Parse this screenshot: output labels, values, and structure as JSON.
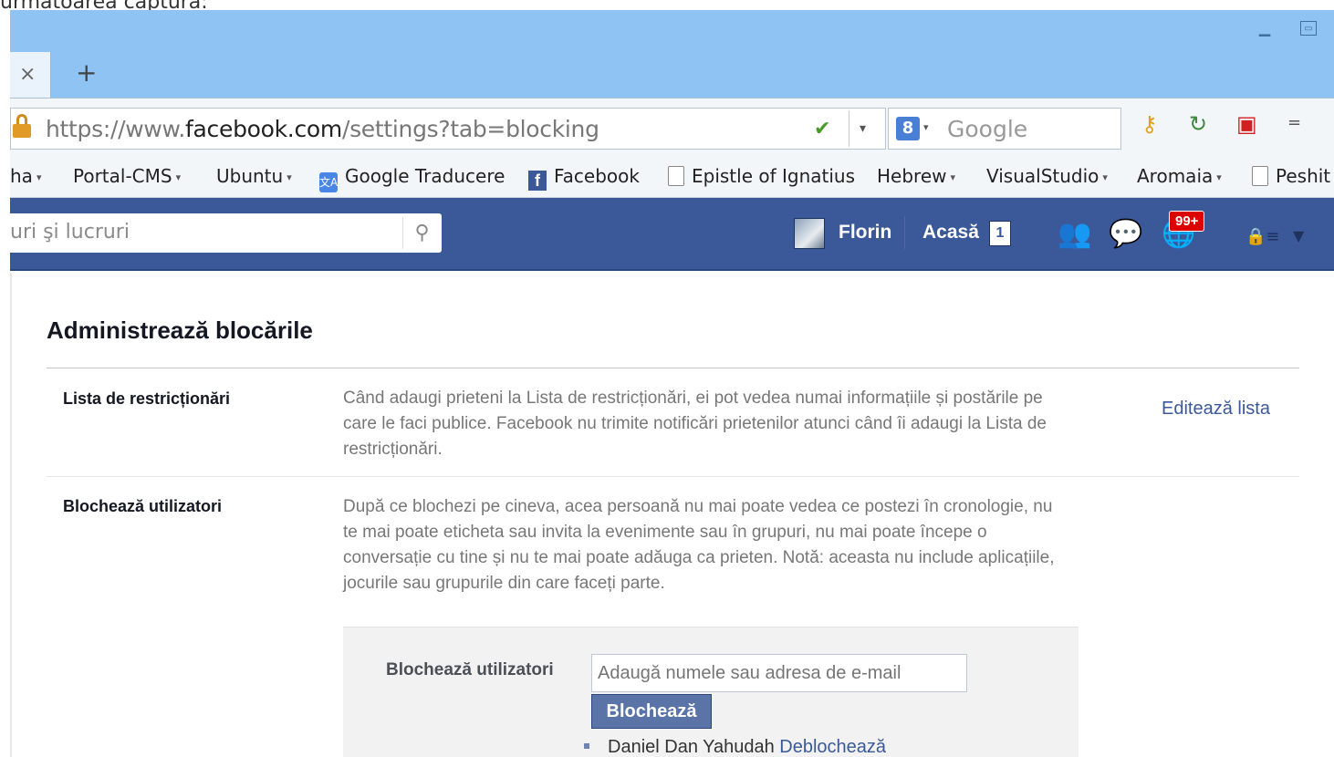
{
  "caption": "următoarea captură:",
  "window": {
    "minimize_icon": "minimize-icon",
    "maximize_icon": "maximize-icon"
  },
  "tab": {
    "close": "×",
    "new_tab": "+"
  },
  "navbar": {
    "url_prefix": "https://www.",
    "url_domain": "facebook.com",
    "url_path": "/settings?tab=blocking",
    "dropdown": "▾",
    "search_engine_badge": "8",
    "search_placeholder": "Google",
    "search_caret": "▾",
    "menu_caret": "="
  },
  "bookmarks": [
    {
      "label": "ha",
      "caret": "▾",
      "icon": ""
    },
    {
      "label": "Portal-CMS",
      "caret": "▾",
      "icon": ""
    },
    {
      "label": "Ubuntu",
      "caret": "▾",
      "icon": ""
    },
    {
      "label": "Google Traducere",
      "caret": "",
      "icon": "translate"
    },
    {
      "label": "Facebook",
      "caret": "",
      "icon": "facebook"
    },
    {
      "label": "Epistle of Ignatius",
      "caret": "",
      "icon": "page"
    },
    {
      "label": "Hebrew",
      "caret": "▾",
      "icon": ""
    },
    {
      "label": "VisualStudio",
      "caret": "▾",
      "icon": ""
    },
    {
      "label": "Aromaia",
      "caret": "▾",
      "icon": ""
    },
    {
      "label": "Peshit",
      "caret": "",
      "icon": "page"
    }
  ],
  "fb": {
    "search_placeholder": "uri şi lucruri",
    "search_icon": "⚲",
    "user_name": "Florin",
    "home_label": "Acasă",
    "home_count": "1",
    "notifications_badge": "99+"
  },
  "settings": {
    "title": "Administrează blocările",
    "restrict": {
      "label": "Lista de restricționări",
      "description": "Când adaugi prieteni la Lista de restricționări, ei pot vedea numai informațiile și postările pe care le faci publice. Facebook nu trimite notificări prietenilor atunci când îi adaugi la Lista de restricționări.",
      "edit_link": "Editează lista"
    },
    "block_users": {
      "label": "Blochează utilizatori",
      "description": "După ce blochezi pe cineva, acea persoană nu mai poate vedea ce postezi în cronologie, nu te mai poate eticheta sau invita la evenimente sau în grupuri, nu mai poate începe o conversație cu tine și nu te mai poate adăuga ca prieten. Notă: aceasta nu include aplicațiile, jocurile sau grupurile din care faceți parte.",
      "form_label": "Blochează utilizatori",
      "input_placeholder": "Adaugă numele sau adresa de e-mail",
      "block_button": "Blochează",
      "blocked": [
        {
          "name": "Daniel Dan Yahudah",
          "action": "Deblochează"
        }
      ]
    }
  }
}
